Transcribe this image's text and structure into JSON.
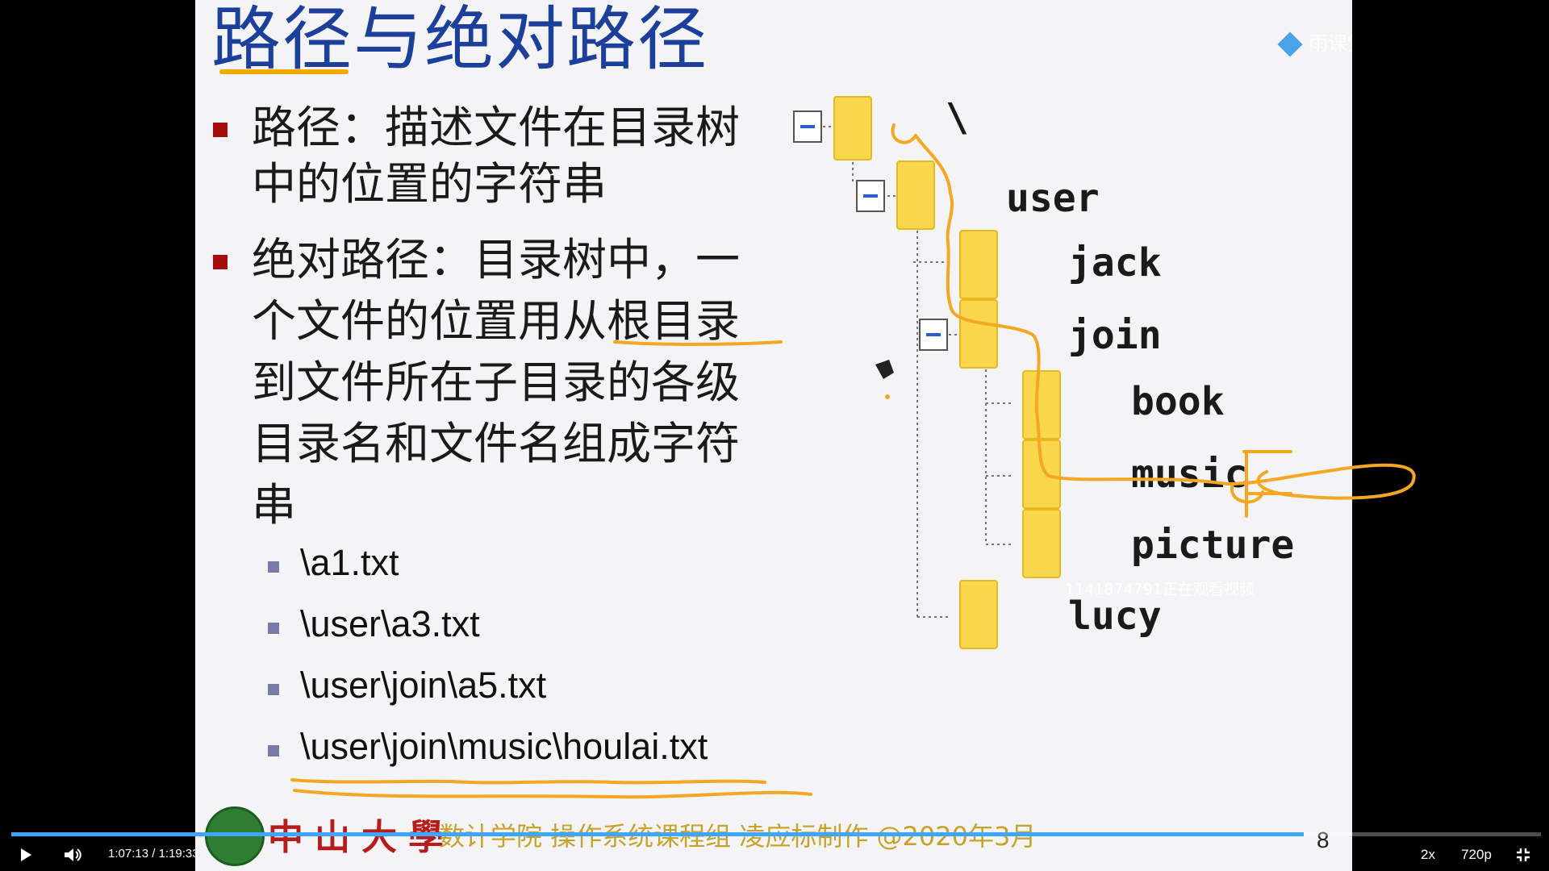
{
  "slide": {
    "title": "路径与绝对路径",
    "bullet1": [
      "路径：描述文件在目录树",
      "中的位置的字符串"
    ],
    "bullet2": [
      "绝对路径：目录树中，一",
      "个文件的位置用从根目录",
      "到文件所在子目录的各级",
      "目录名和文件名组成字符",
      "串"
    ],
    "examples": [
      "\\a1.txt",
      "\\user\\a3.txt",
      "\\user\\join\\a5.txt",
      "\\user\\join\\music\\houlai.txt"
    ],
    "tree": {
      "root": "\\",
      "user": "user",
      "jack": "jack",
      "join": "join",
      "book": "book",
      "music": "music",
      "picture": "picture",
      "lucy": "lucy"
    },
    "footer": {
      "school": "中山大學",
      "credit": "数计学院 操作系统课程组 凌应标制作 @2020年3月"
    },
    "page_number": "8",
    "watermark": "雨课堂",
    "viewer_note": "1141874791正在观看视频"
  },
  "player": {
    "current_time": "1:07:13",
    "duration": "1:19:33",
    "progress": 0.845,
    "speed_label": "2x",
    "quality_label": "720p",
    "icons": {
      "play": "play-icon",
      "volume": "volume-icon",
      "exit_fullscreen": "exit-fullscreen-icon"
    }
  },
  "colors": {
    "title_blue": "#1d3f9c",
    "bullet_red": "#a60d0d",
    "annotation_orange": "#f5a623",
    "progress_blue": "#3ea6ff",
    "folder_yellow": "#f9d64c"
  }
}
